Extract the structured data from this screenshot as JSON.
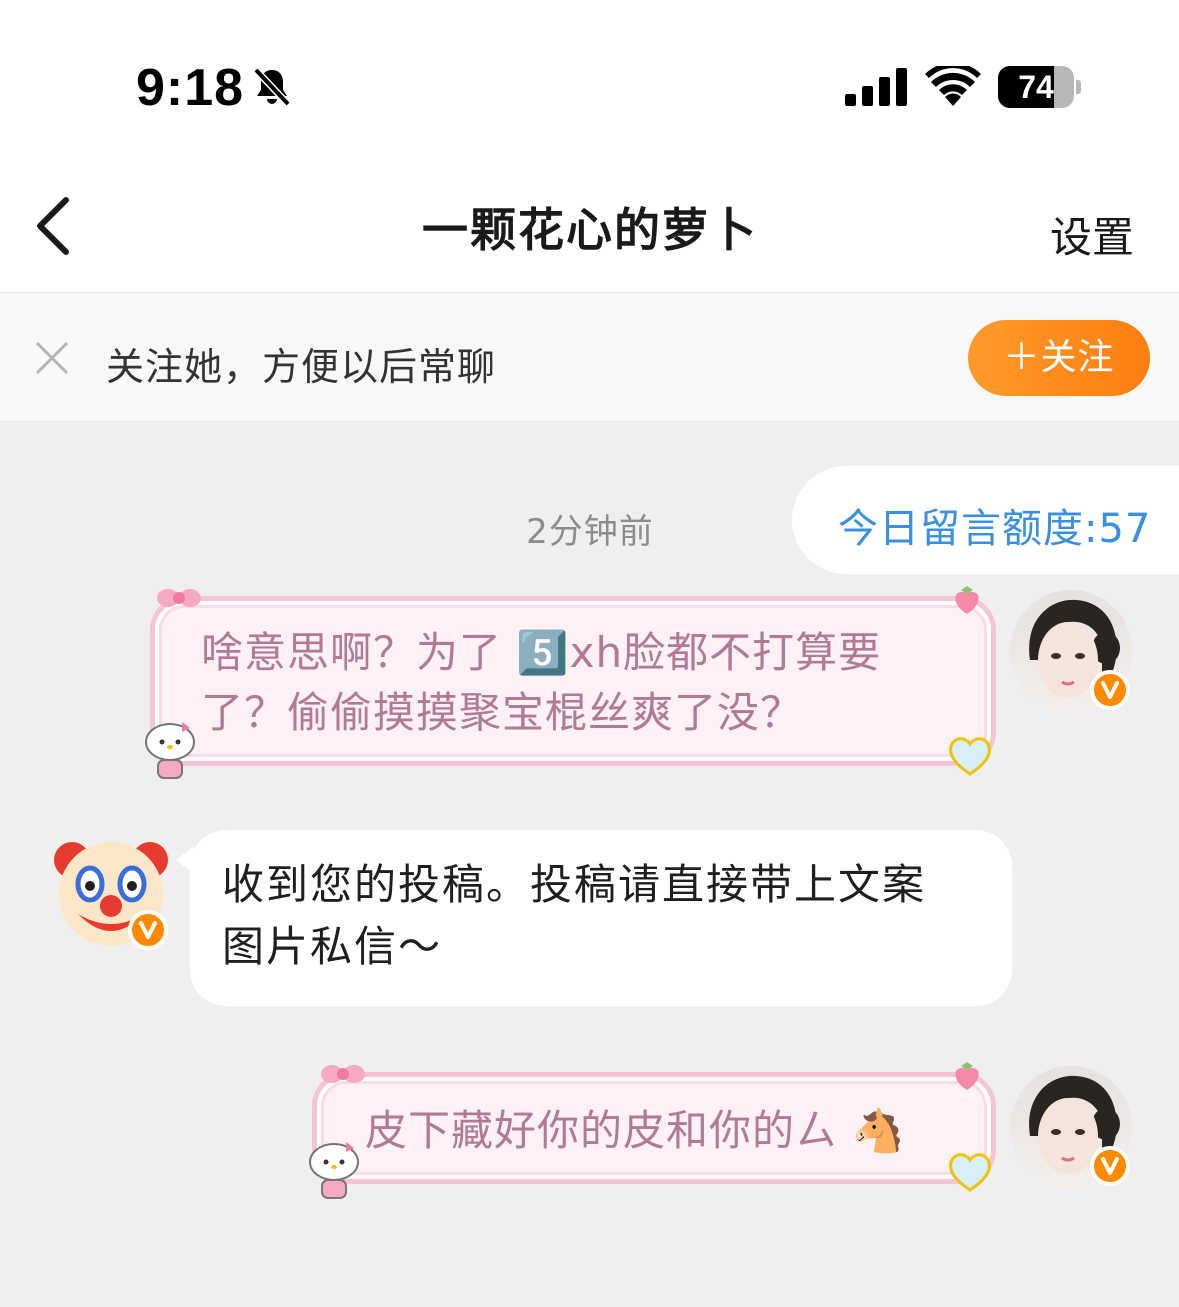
{
  "status_bar": {
    "time": "9:18",
    "battery_percent": 74,
    "battery_text": "74",
    "icons": [
      "bell-muted-icon",
      "signal-icon",
      "wifi-icon",
      "battery-icon"
    ]
  },
  "nav": {
    "title": "一颗花心的萝卜",
    "settings_label": "设置",
    "back_icon": "chevron-left-icon"
  },
  "follow_banner": {
    "text": "关注她，方便以后常聊",
    "button_label": "＋关注",
    "close_icon": "close-icon"
  },
  "chat": {
    "quota_text": "今日留言额度:57",
    "timestamp": "2分钟前",
    "messages": [
      {
        "sender": "me",
        "lines": [
          "啥意思啊？为了",
          "xh脸都不打算要",
          "了？偷偷摸摸聚宝棍丝爽了没？"
        ],
        "emoji": "5️⃣"
      },
      {
        "sender": "other",
        "text": "收到您的投稿。投稿请直接带上文案图片私信～"
      },
      {
        "sender": "me",
        "text": "皮下藏好你的皮和你的ㄙ",
        "emoji": "🐴"
      }
    ]
  },
  "colors": {
    "accent_orange": "#ff8a00",
    "quota_blue": "#3a8fe0",
    "pink_text": "#b07a94",
    "background": "#efefef"
  }
}
